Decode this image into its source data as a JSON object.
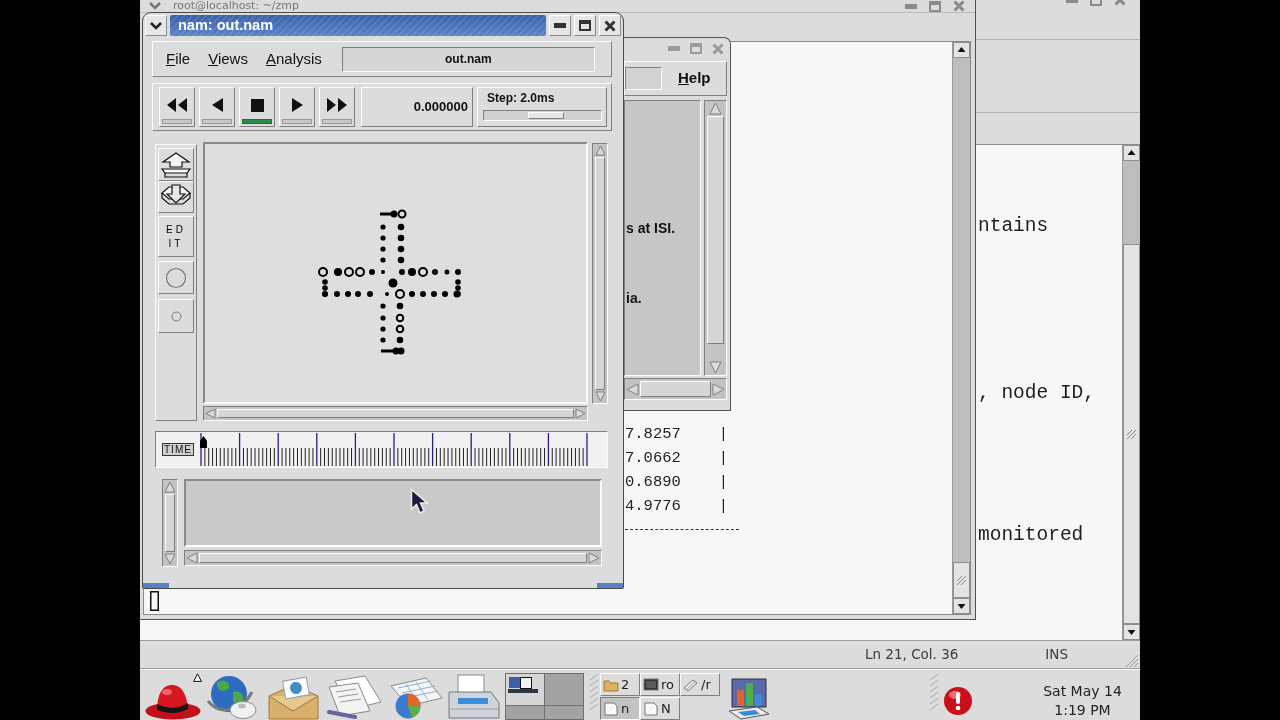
{
  "editor_window": {
    "text_lines": [
      "ntains",
      ", node ID,",
      "monitored"
    ],
    "status_bar": {
      "position": "Ln 21, Col. 36",
      "mode": "INS"
    }
  },
  "terminal_window": {
    "title": "root@localhost: ~/zmp",
    "rows": [
      {
        "cells": [
          "7.8257",
          "|"
        ]
      },
      {
        "cells": [
          "7.0662",
          "|"
        ]
      },
      {
        "cells": [
          "0.6890",
          "|"
        ]
      },
      {
        "cells": [
          "4.9776",
          "|"
        ]
      }
    ]
  },
  "dialog_window": {
    "menu": [
      "Help"
    ],
    "text_lines": [
      "s at ISI.",
      "ia."
    ]
  },
  "nam_window": {
    "title": "nam: out.nam",
    "menu": [
      "File",
      "Views",
      "Analysis"
    ],
    "file_name": "out.nam",
    "playback_buttons": [
      {
        "kind": "rewind",
        "selected": false
      },
      {
        "kind": "back",
        "selected": false
      },
      {
        "kind": "stop",
        "selected": true
      },
      {
        "kind": "play",
        "selected": false
      },
      {
        "kind": "fast_forward",
        "selected": false
      }
    ],
    "time": "0.000000",
    "step": {
      "label": "Step: 2.0ms",
      "level": 0.53
    },
    "tools": [
      {
        "kind": "zoom_in"
      },
      {
        "kind": "zoom_out"
      },
      {
        "kind": "edit",
        "label": "EDIT"
      },
      {
        "kind": "node"
      },
      {
        "kind": "small_node"
      }
    ],
    "timeline": {
      "label": "TIME",
      "level": 0
    }
  },
  "taskbar": {
    "workspaces": [
      {
        "selected": true
      },
      {
        "selected": false
      },
      {
        "selected": false
      },
      {
        "selected": false
      }
    ],
    "tasks": [
      {
        "kind": "folder",
        "label": "2",
        "selected": false
      },
      {
        "kind": "terminal",
        "label": "ro",
        "selected": false
      },
      {
        "kind": "editor",
        "label": "/r",
        "selected": false
      },
      {
        "kind": "document",
        "label": "n",
        "selected": true
      },
      {
        "kind": "document",
        "label": "N",
        "selected": false
      }
    ],
    "clock": {
      "date": "Sat May 14",
      "time": "1:19 PM"
    }
  }
}
